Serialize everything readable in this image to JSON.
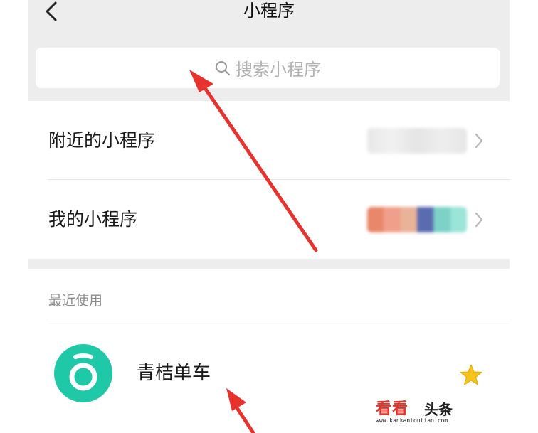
{
  "header": {
    "title": "小程序",
    "back_icon": "chevron-left-icon"
  },
  "search": {
    "placeholder": "搜索小程序",
    "icon": "search-icon"
  },
  "menu": {
    "items": [
      {
        "label": "附近的小程序",
        "icon": "chevron-right-icon"
      },
      {
        "label": "我的小程序",
        "icon": "chevron-right-icon"
      }
    ]
  },
  "recent": {
    "title": "最近使用",
    "apps": [
      {
        "name": "青桔单车",
        "icon": "qingju-logo-icon",
        "starred": true,
        "brand_color": "#1fc8a6"
      }
    ]
  },
  "annotations": {
    "arrow_color": "#e8322e"
  },
  "watermark": {
    "brand": "看看",
    "suffix": "头条",
    "url": "www.kankantoutiao.com"
  }
}
